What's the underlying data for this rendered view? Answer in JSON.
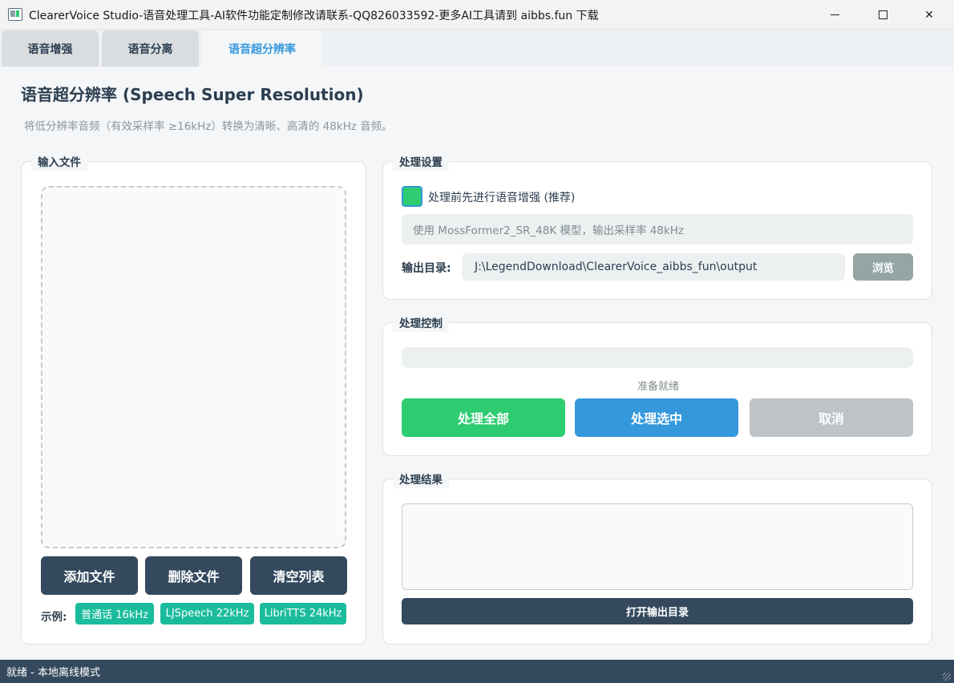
{
  "window": {
    "title": "ClearerVoice Studio-语音处理工具-AI软件功能定制修改请联系-QQ826033592-更多AI工具请到 aibbs.fun 下载",
    "minimize_icon": "minimize-icon",
    "maximize_icon": "maximize-icon",
    "close_icon": "close-icon",
    "close_glyph": "✕"
  },
  "tabs": [
    {
      "label": "语音增强",
      "active": false
    },
    {
      "label": "语音分离",
      "active": false
    },
    {
      "label": "语音超分辨率",
      "active": true
    }
  ],
  "header": {
    "title": "语音超分辨率 (Speech Super Resolution)",
    "subtitle": "将低分辨率音频（有效采样率 ≥16kHz）转换为清晰、高清的 48kHz 音频。"
  },
  "input_group": {
    "label": "输入文件",
    "buttons": {
      "add": "添加文件",
      "delete": "删除文件",
      "clear": "清空列表"
    },
    "examples_label": "示例:",
    "examples": [
      "普通话 16kHz",
      "LJSpeech 22kHz",
      "LibriTTS 24kHz"
    ]
  },
  "settings_group": {
    "label": "处理设置",
    "enhance_checkbox": {
      "label": "处理前先进行语音增强 (推荐)",
      "checked": true
    },
    "model_info": "使用 MossFormer2_SR_48K 模型，输出采样率 48kHz",
    "output_dir_label": "输出目录:",
    "output_dir_value": "J:\\LegendDownload\\ClearerVoice_aibbs_fun\\output",
    "browse_label": "浏览"
  },
  "control_group": {
    "label": "处理控制",
    "progress": 0,
    "status": "准备就绪",
    "buttons": {
      "process_all": "处理全部",
      "process_selected": "处理选中",
      "cancel": "取消"
    }
  },
  "result_group": {
    "label": "处理结果",
    "open_output_label": "打开输出目录"
  },
  "statusbar": {
    "text": "就绪 - 本地离线模式"
  },
  "colors": {
    "dark": "#34495e",
    "green": "#2ecc71",
    "blue": "#3498db",
    "teal": "#1abc9c",
    "gray_button": "#95a5a6",
    "disabled": "#bdc3c7"
  }
}
